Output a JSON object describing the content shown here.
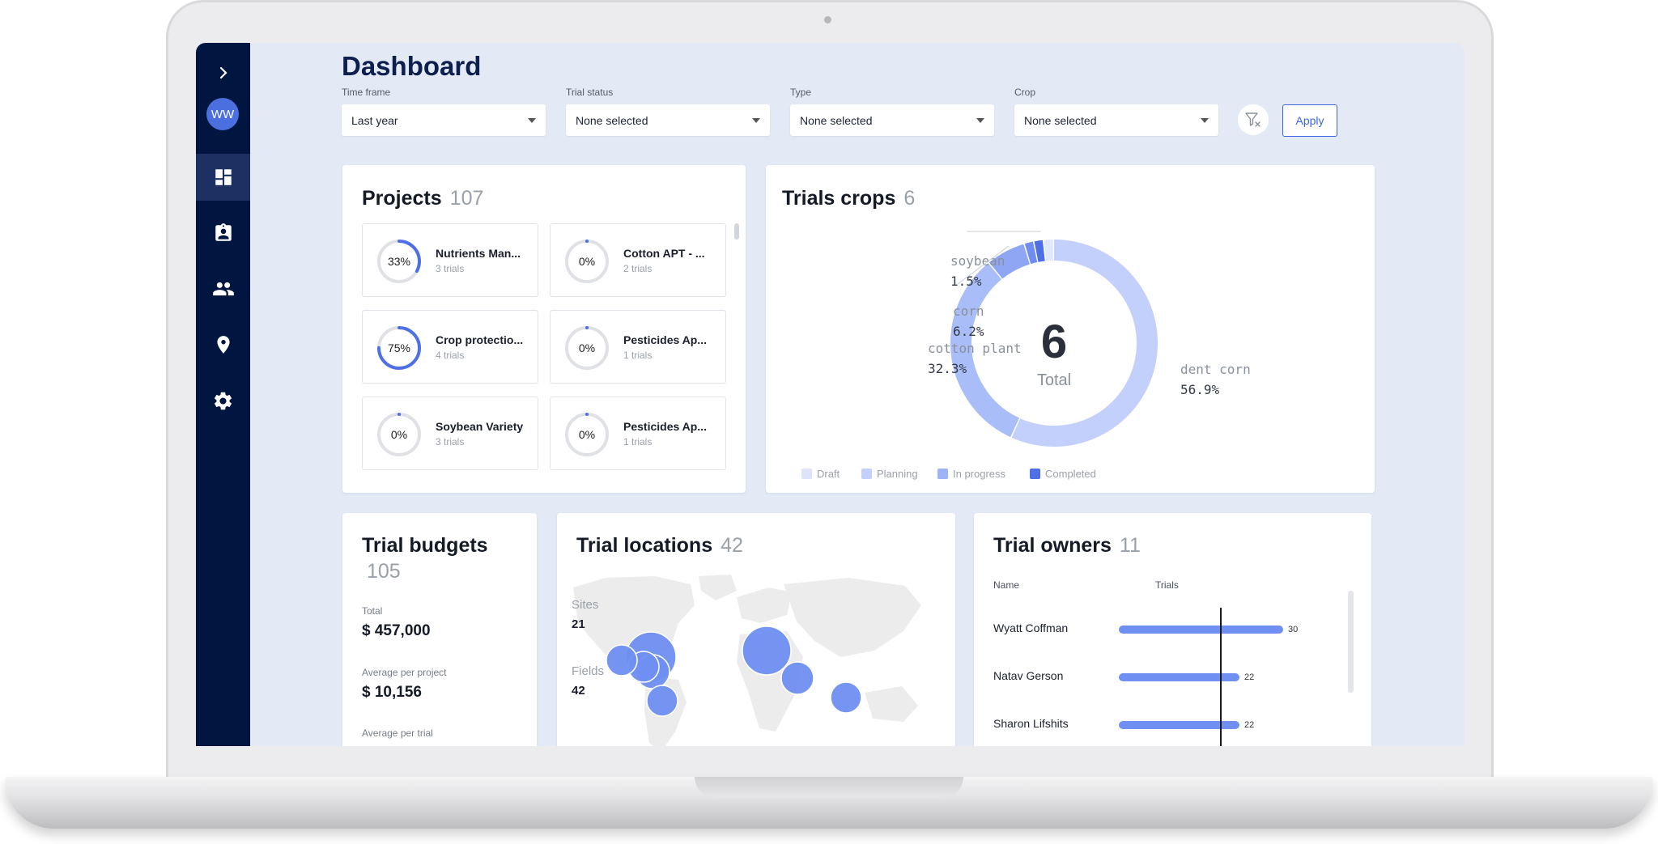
{
  "sidebar": {
    "expand_icon": "chevron-right-icon",
    "avatar_initials": "WW",
    "items": [
      {
        "name": "dashboard",
        "icon": "dashboard-icon",
        "active": true
      },
      {
        "name": "trials",
        "icon": "clipboard-icon",
        "active": false
      },
      {
        "name": "users",
        "icon": "people-icon",
        "active": false
      },
      {
        "name": "locations",
        "icon": "location-pin-icon",
        "active": false
      },
      {
        "name": "settings",
        "icon": "gear-icon",
        "active": false
      }
    ]
  },
  "header": {
    "title": "Dashboard",
    "filters": [
      {
        "label": "Time frame",
        "value": "Last year"
      },
      {
        "label": "Trial status",
        "value": "None selected"
      },
      {
        "label": "Type",
        "value": "None selected"
      },
      {
        "label": "Crop",
        "value": "None selected"
      }
    ],
    "clear_filter_icon": "filter-clear-icon",
    "apply_label": "Apply"
  },
  "projects": {
    "title": "Projects",
    "count": "107",
    "items": [
      {
        "name": "Nutrients Man...",
        "trials": "3 trials",
        "progress": "33%",
        "fraction": 0.33
      },
      {
        "name": "Cotton APT - ...",
        "trials": "2 trials",
        "progress": "0%",
        "fraction": 0
      },
      {
        "name": "Crop protectio...",
        "trials": "4 trials",
        "progress": "75%",
        "fraction": 0.75
      },
      {
        "name": "Pesticides Ap...",
        "trials": "1 trials",
        "progress": "0%",
        "fraction": 0
      },
      {
        "name": "Soybean Variety",
        "trials": "3 trials",
        "progress": "0%",
        "fraction": 0
      },
      {
        "name": "Pesticides Ap...",
        "trials": "1 trials",
        "progress": "0%",
        "fraction": 0
      }
    ]
  },
  "trials_crops": {
    "title": "Trials crops",
    "count": "6",
    "center_value": "6",
    "center_label": "Total",
    "slices": [
      {
        "name": "dent corn",
        "pct_label": "56.9%",
        "value": 56.9,
        "color": "#c3d0fb"
      },
      {
        "name": "cotton plant",
        "pct_label": "32.3%",
        "value": 32.3,
        "color": "#a9bdf8"
      },
      {
        "name": "corn",
        "pct_label": "6.2%",
        "value": 6.2,
        "color": "#8ea6f4"
      },
      {
        "name": "",
        "pct_label": "",
        "value": 1.5,
        "color": "#6f8ef0"
      },
      {
        "name": "soybean",
        "pct_label": "1.5%",
        "value": 1.5,
        "color": "#4e6fe6"
      },
      {
        "name": "",
        "pct_label": "",
        "value": 1.6,
        "color": "#e2e8fb"
      }
    ],
    "legend": [
      {
        "label": "Draft",
        "color": "#dde4f8"
      },
      {
        "label": "Planning",
        "color": "#c3d0fb"
      },
      {
        "label": "In progress",
        "color": "#9db4f6"
      },
      {
        "label": "Completed",
        "color": "#4e6fe6"
      }
    ]
  },
  "trial_budgets": {
    "title": "Trial budgets",
    "count": "105",
    "total_label": "Total",
    "total_value": "$ 457,000",
    "avg_project_label": "Average per project",
    "avg_project_value": "$ 10,156",
    "avg_trial_label": "Average per trial"
  },
  "trial_locations": {
    "title": "Trial locations",
    "count": "42",
    "sites_label": "Sites",
    "sites_value": "21",
    "fields_label": "Fields",
    "fields_value": "42"
  },
  "trial_owners": {
    "title": "Trial owners",
    "count": "11",
    "col_name": "Name",
    "col_trials": "Trials",
    "max": 30,
    "rows": [
      {
        "name": "Wyatt Coffman",
        "trials": 30,
        "label": "30"
      },
      {
        "name": "Natav Gerson",
        "trials": 22,
        "label": "22"
      },
      {
        "name": "Sharon Lifshits",
        "trials": 22,
        "label": "22"
      }
    ]
  }
}
